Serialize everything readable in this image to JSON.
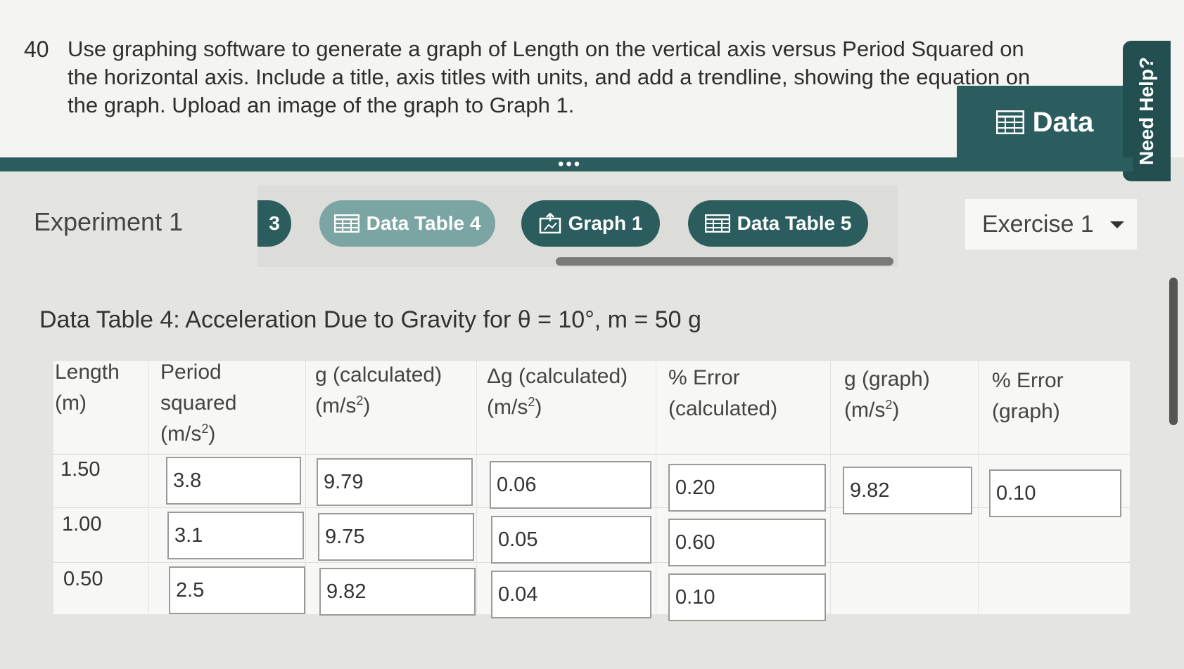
{
  "question": {
    "number": "40",
    "text": "Use graphing software to generate a graph of Length on the vertical axis versus Period Squared on the horizontal axis. Include a title, axis titles with units, and add a trendline, showing the equation on the graph. Upload an image of the graph to Graph 1."
  },
  "data_tab": {
    "label": "Data",
    "icon": "table-grid-icon"
  },
  "need_help": {
    "label": "Need Help?"
  },
  "more_dots": "•••",
  "experiment": {
    "label": "Experiment 1"
  },
  "tabs": [
    {
      "label": "3",
      "icon": ""
    },
    {
      "label": "Data Table 4",
      "icon": "table-grid-icon"
    },
    {
      "label": "Graph 1",
      "icon": "upload-icon"
    },
    {
      "label": "Data Table 5",
      "icon": "table-grid-icon"
    }
  ],
  "exercise_select": {
    "value": "Exercise 1"
  },
  "table": {
    "title": "Data Table 4: Acceleration Due to Gravity for θ = 10°, m = 50 g",
    "headers": [
      {
        "line1": "Length",
        "line2": "(m)",
        "line3": ""
      },
      {
        "line1": "Period",
        "line2": "squared",
        "line3": "(m/s",
        "sup": "2",
        "tail": ")"
      },
      {
        "line1": "g (calculated)",
        "line2": "(m/s",
        "sup": "2",
        "tail": ")"
      },
      {
        "line1": "Δg (calculated)",
        "line2": "(m/s",
        "sup": "2",
        "tail": ")"
      },
      {
        "line1": "% Error",
        "line2": "(calculated)"
      },
      {
        "line1": "g (graph)",
        "line2": "(m/s",
        "sup": "2",
        "tail": ")"
      },
      {
        "line1": "% Error",
        "line2": "(graph)"
      }
    ],
    "rows": [
      {
        "length": "1.50",
        "period_sq": "3.8",
        "g_calc": "9.79",
        "dg_calc": "0.06",
        "err_calc": "0.20",
        "g_graph": "9.82",
        "err_graph": "0.10"
      },
      {
        "length": "1.00",
        "period_sq": "3.1",
        "g_calc": "9.75",
        "dg_calc": "0.05",
        "err_calc": "0.60"
      },
      {
        "length": "0.50",
        "period_sq": "2.5",
        "g_calc": "9.82",
        "dg_calc": "0.04",
        "err_calc": "0.10"
      }
    ]
  },
  "colors": {
    "teal_dark": "#2c5d5e",
    "teal_light": "#7ba5a3",
    "background": "#e4e4e0"
  }
}
